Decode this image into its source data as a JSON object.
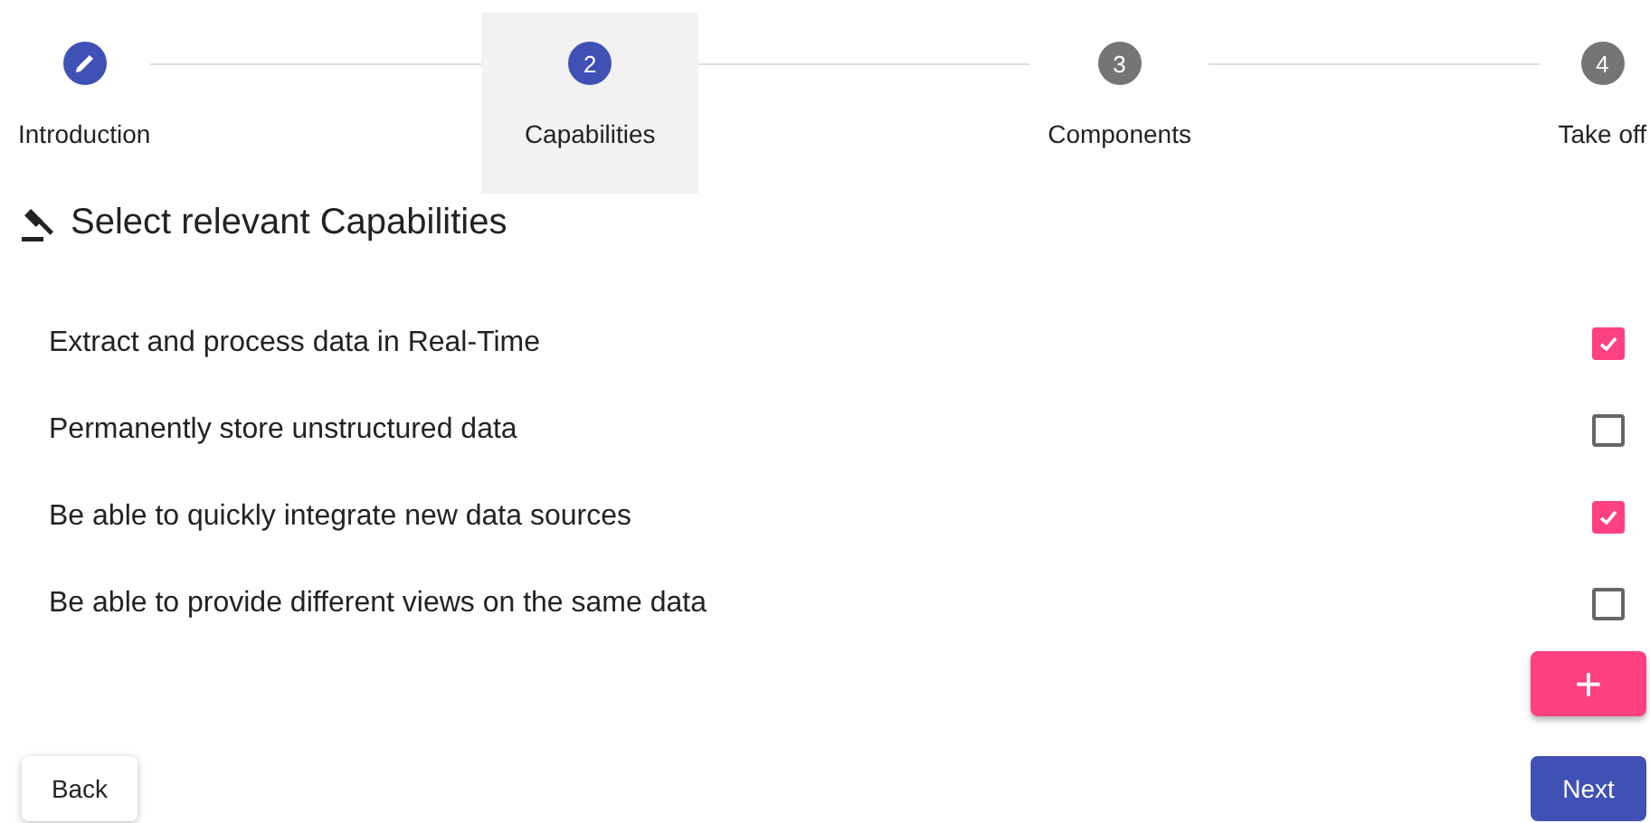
{
  "stepper": [
    {
      "kind": "edit",
      "label": "Introduction",
      "selected": false,
      "active": true
    },
    {
      "kind": "number",
      "number": "2",
      "label": "Capabilities",
      "selected": true,
      "active": true
    },
    {
      "kind": "number",
      "number": "3",
      "label": "Components",
      "selected": false,
      "active": false
    },
    {
      "kind": "number",
      "number": "4",
      "label": "Take off",
      "selected": false,
      "active": false
    }
  ],
  "heading": "Select relevant Capabilities",
  "capabilities": [
    {
      "label": "Extract and process data in Real-Time",
      "checked": true
    },
    {
      "label": "Permanently store unstructured data",
      "checked": false
    },
    {
      "label": "Be able to quickly integrate new data sources",
      "checked": true
    },
    {
      "label": "Be able to provide different views on the same data",
      "checked": false
    }
  ],
  "add_button": "+",
  "back_button": "Back",
  "next_button": "Next"
}
